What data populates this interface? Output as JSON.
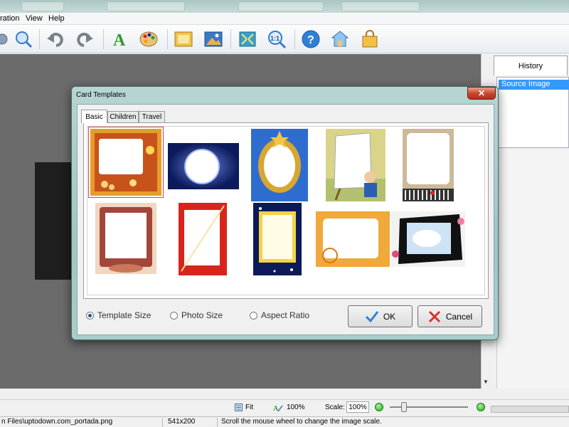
{
  "app": {
    "menu": [
      "ration",
      "View",
      "Help"
    ]
  },
  "toolbar": {
    "icons": [
      "zoom-in-icon",
      "undo-icon",
      "redo-icon",
      "text-icon",
      "palette-icon",
      "frame-icon",
      "picture-icon",
      "fit-icon",
      "actual-size-icon",
      "help-icon",
      "home-icon",
      "bag-icon"
    ]
  },
  "history": {
    "tab_label": "History",
    "items": [
      "Source Image"
    ]
  },
  "dialog": {
    "title": "Card Templates",
    "close_label": "✕",
    "tabs": [
      "Basic",
      "Children",
      "Travel"
    ],
    "options": {
      "template_size": "Template Size",
      "photo_size": "Photo Size",
      "aspect_ratio": "Aspect Ratio",
      "selected": "template_size"
    },
    "ok_label": "OK",
    "cancel_label": "Cancel"
  },
  "zoom": {
    "fit_label": "Fit",
    "actual_label": "100%",
    "scale_label": "Scale:",
    "scale_value": "100%"
  },
  "status": {
    "file": "n Files\\uptodown.com_portada.png",
    "dimensions": "541x200",
    "hint": "Scroll the mouse wheel to change the image scale."
  },
  "colors": {
    "dialog_frame": "#a9cdca",
    "selection": "#3399ff",
    "close_red": "#c7432a",
    "canvas": "#6b6b6b"
  }
}
